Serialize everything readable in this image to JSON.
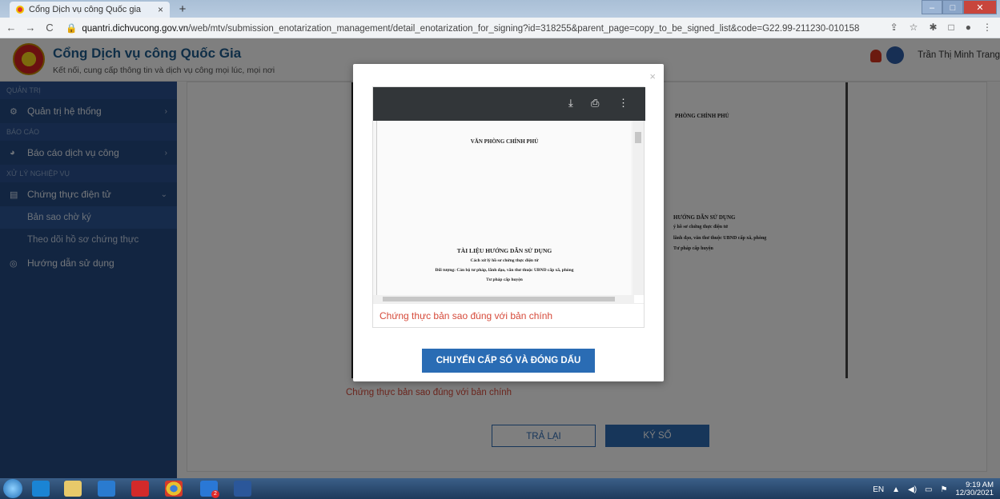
{
  "browser": {
    "tab_title": "Cổng Dịch vụ công Quốc gia",
    "tab_close": "×",
    "new_tab": "+",
    "url_host": "quantri.dichvucong.gov.vn",
    "url_path": "/web/mtv/submission_enotarization_management/detail_enotarization_for_signing?id=318255&parent_page=copy_to_be_signed_list&code=G22.99-211230-010158"
  },
  "header": {
    "title": "Cổng Dịch vụ công Quốc Gia",
    "subtitle": "Kết nối, cung cấp thông tin và dịch vụ công mọi lúc, mọi nơi",
    "user_name": "Trần Thị Minh Trang"
  },
  "sidebar": {
    "sections": [
      {
        "label": "QUẢN TRỊ",
        "items": [
          {
            "label": "Quản trị hệ thống"
          }
        ]
      },
      {
        "label": "BÁO CÁO",
        "items": [
          {
            "label": "Báo cáo dịch vụ công"
          }
        ]
      },
      {
        "label": "XỬ LÝ NGHIỆP VỤ",
        "items": [
          {
            "label": "Chứng thực điện tử"
          }
        ]
      }
    ],
    "subitems": [
      "Bản sao chờ ký",
      "Theo dõi hồ sơ chứng thực"
    ],
    "guide": "Hướng dẫn sử dụng"
  },
  "background": {
    "doc_org": "PHÒNG CHÍNH PHỦ",
    "doc_title": "HƯỚNG DẪN SỬ DỤNG",
    "doc_line1": "ý hồ sơ chứng thực điện tử",
    "doc_line2": "lãnh đạo, văn thư thuộc UBND cấp xã, phòng",
    "doc_line3": "Tư pháp cấp huyện",
    "caption": "Chứng thực bản sao đúng với bản chính",
    "btn_back": "TRẢ LẠI",
    "btn_sign": "KÝ SỐ"
  },
  "modal": {
    "close": "×",
    "doc_org": "VĂN PHÒNG CHÍNH PHỦ",
    "doc_title": "TÀI LIỆU HƯỚNG DẪN SỬ DỤNG",
    "doc_line1": "Cách xử lý hồ sơ chứng thực điện tử",
    "doc_line2": "Đối tượng: Cán bộ tư pháp, lãnh đạo, văn thư thuộc UBND cấp xã, phòng",
    "doc_line3": "Tư pháp cấp huyện",
    "caption": "Chứng thực bản sao đúng với bản chính",
    "action_button": "CHUYỂN CẤP SỐ VÀ ĐÓNG DẤU"
  },
  "taskbar": {
    "lang": "EN",
    "time": "9:19 AM",
    "date": "12/30/2021",
    "zalo_badge": "2"
  }
}
